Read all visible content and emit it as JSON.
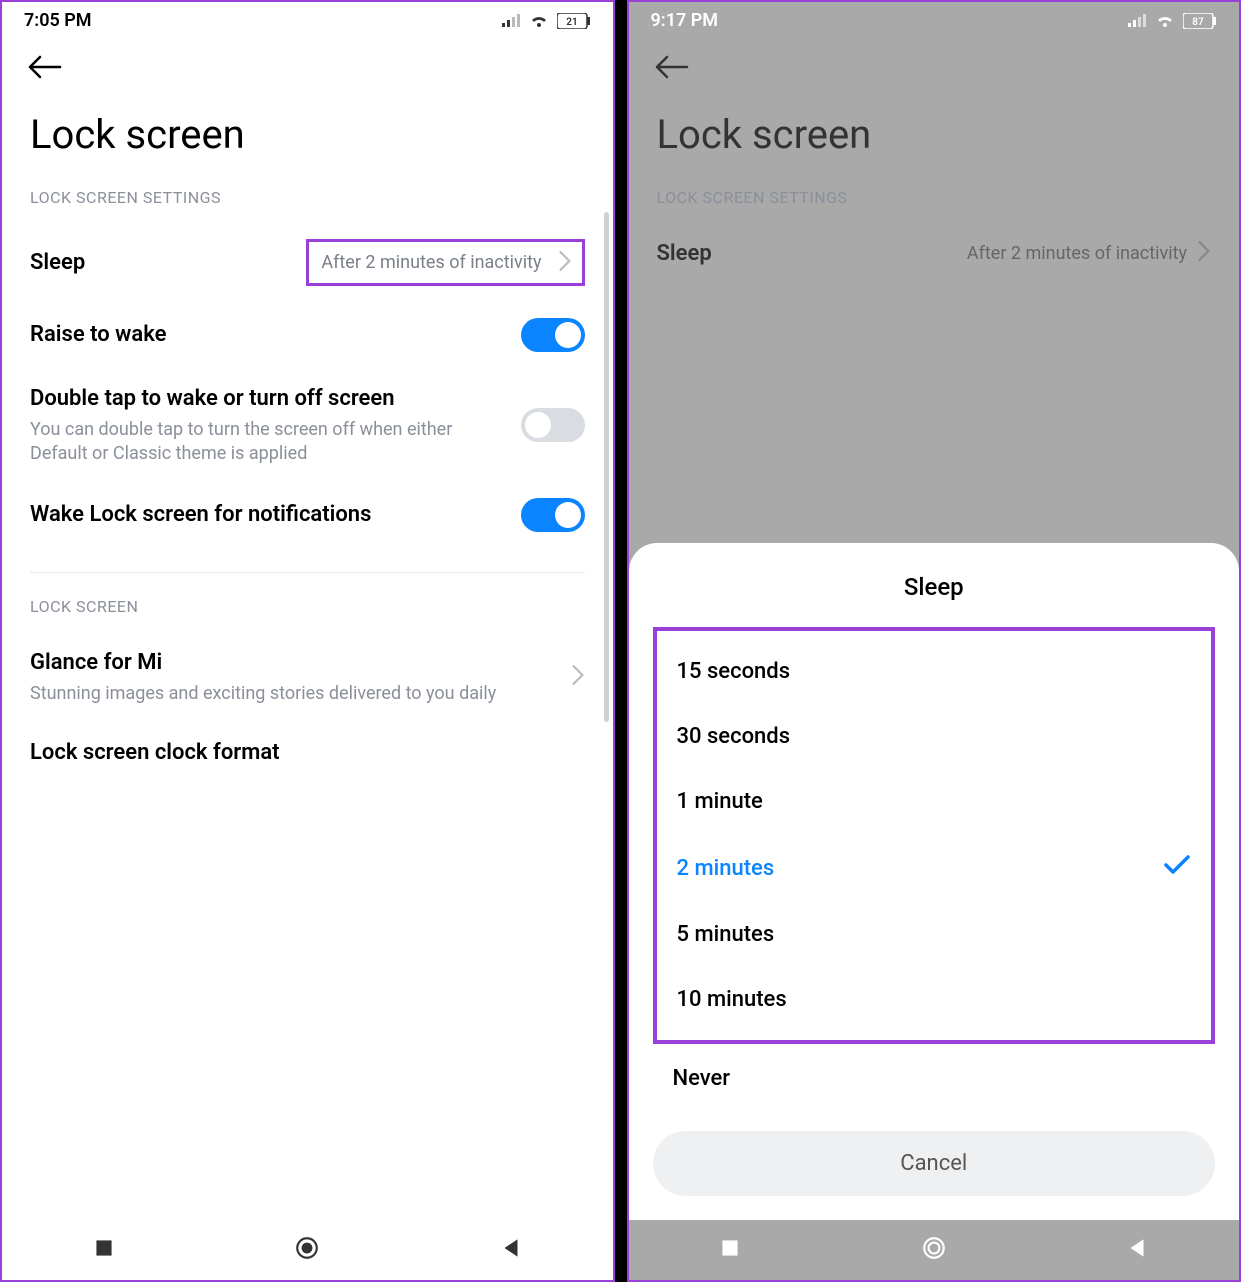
{
  "left": {
    "status": {
      "time": "7:05 PM",
      "battery": "21"
    },
    "page_title": "Lock screen",
    "section1_label": "LOCK SCREEN SETTINGS",
    "sleep": {
      "title": "Sleep",
      "value": "After 2 minutes of inactivity"
    },
    "raise": {
      "title": "Raise to wake"
    },
    "doubletap": {
      "title": "Double tap to wake or turn off screen",
      "sub": "You can double tap to turn the screen off when either Default or Classic theme is applied"
    },
    "wake_notif": {
      "title": "Wake Lock screen for notifications"
    },
    "section2_label": "LOCK SCREEN",
    "glance": {
      "title": "Glance for Mi",
      "sub": "Stunning images and exciting stories delivered to you daily"
    },
    "clock_format": {
      "title": "Lock screen clock format"
    }
  },
  "right": {
    "status": {
      "time": "9:17 PM",
      "battery": "87"
    },
    "page_title": "Lock screen",
    "section1_label": "LOCK SCREEN SETTINGS",
    "sleep": {
      "title": "Sleep",
      "value": "After 2 minutes of inactivity"
    },
    "sheet": {
      "title": "Sleep",
      "options": [
        "15 seconds",
        "30 seconds",
        "1 minute",
        "2 minutes",
        "5 minutes",
        "10 minutes"
      ],
      "selected_index": 3,
      "outside_option": "Never",
      "cancel": "Cancel"
    }
  }
}
